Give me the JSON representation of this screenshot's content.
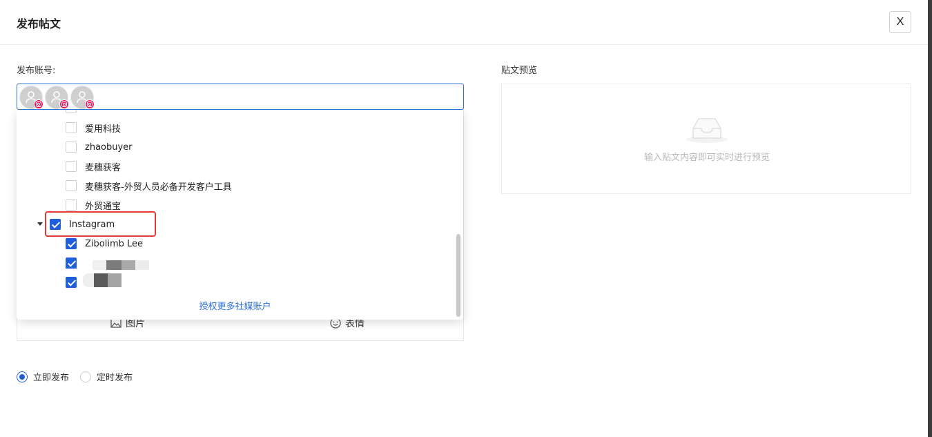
{
  "dialog": {
    "title": "发布帖文",
    "close_label": "X"
  },
  "account_field": {
    "label": "发布账号:",
    "selected_avatars": [
      {
        "icon": "instagram-badge-icon"
      },
      {
        "icon": "instagram-badge-icon"
      },
      {
        "icon": "instagram-badge-icon"
      }
    ]
  },
  "dropdown": {
    "items": [
      {
        "label": "爱用科技",
        "checked": false
      },
      {
        "label": "zhaobuyer",
        "checked": false
      },
      {
        "label": "麦穗获客",
        "checked": false
      },
      {
        "label": "麦穗获客-外贸人员必备开发客户工具",
        "checked": false
      },
      {
        "label": "外贸通宝",
        "checked": false
      }
    ],
    "group": {
      "label": "Instagram",
      "checked": true,
      "expanded": true
    },
    "group_children": [
      {
        "label": "Zibolimb Lee",
        "checked": true
      }
    ],
    "more_link": "授权更多社媒账户"
  },
  "editor_toolbar": {
    "image_label": "图片",
    "emoji_label": "表情"
  },
  "publish_mode": {
    "options": [
      {
        "label": "立即发布",
        "selected": true
      },
      {
        "label": "定时发布",
        "selected": false
      }
    ]
  },
  "preview": {
    "label": "贴文预览",
    "empty_hint": "输入贴文内容即可实时进行预览"
  },
  "colors": {
    "accent": "#1f5fd9",
    "highlight": "#e53935",
    "instagram": "#e91e63"
  }
}
